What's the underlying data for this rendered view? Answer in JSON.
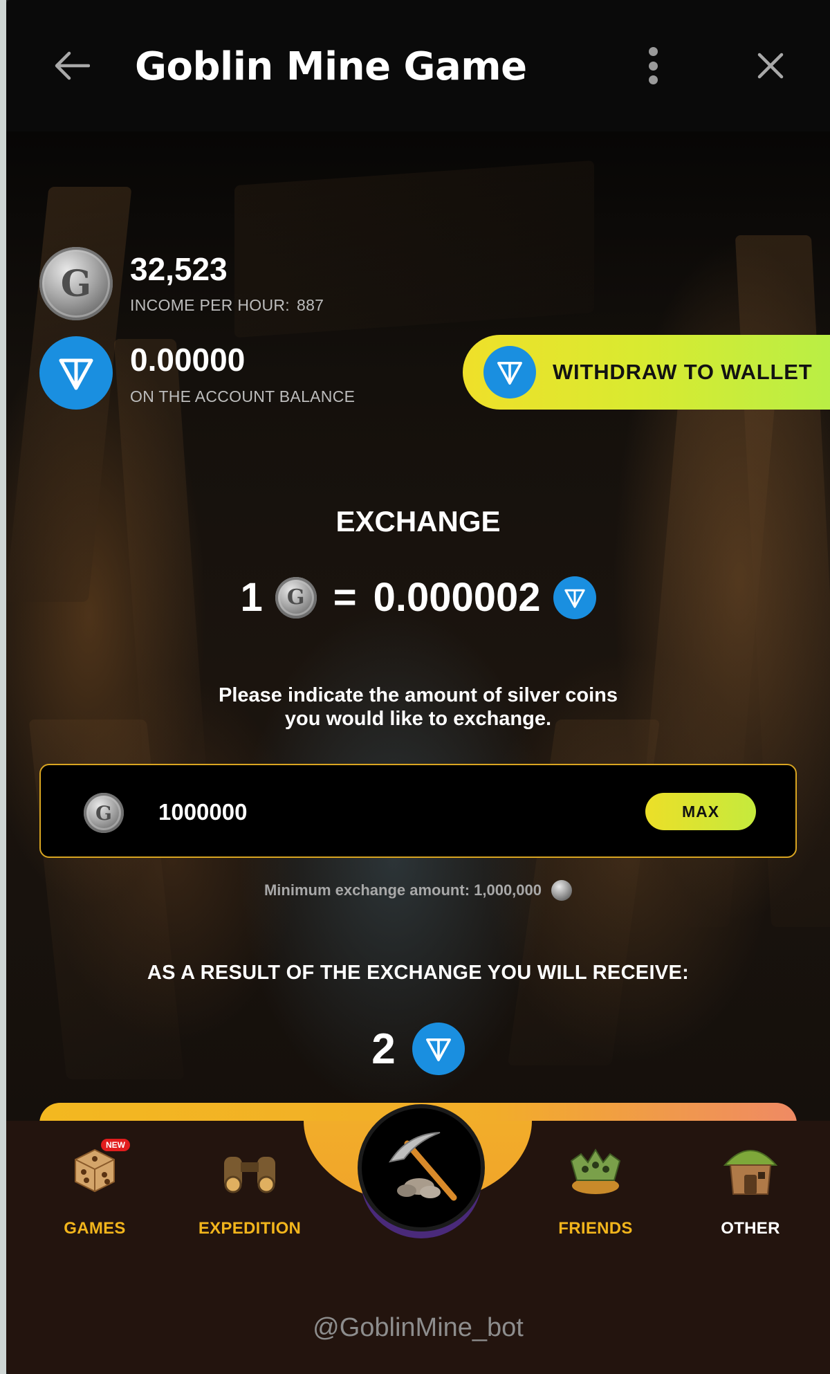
{
  "header": {
    "title": "Goblin Mine Game",
    "back_icon": "arrow-left-icon",
    "menu_icon": "kebab-menu-icon",
    "close_icon": "close-icon"
  },
  "balances": {
    "silver": {
      "value": "32,523",
      "income_label": "INCOME PER HOUR:",
      "income_value": "887",
      "coin_letter": "G"
    },
    "ton": {
      "value": "0.00000",
      "label": "ON THE ACCOUNT BALANCE"
    },
    "withdraw_label": "WITHDRAW TO WALLET"
  },
  "exchange": {
    "title": "EXCHANGE",
    "rate_left": "1",
    "rate_eq": "=",
    "rate_right": "0.000002",
    "instruction_line1": "Please indicate the amount of silver coins",
    "instruction_line2": "you would like to exchange.",
    "amount_value": "1000000",
    "max_label": "MAX",
    "minimum_text": "Minimum exchange amount: 1,000,000",
    "result_label": "AS A RESULT OF THE EXCHANGE YOU WILL RECEIVE:",
    "result_value": "2"
  },
  "nav": {
    "games": {
      "label": "GAMES",
      "badge": "NEW"
    },
    "expedition": {
      "label": "EXPEDITION"
    },
    "mine": {
      "icon": "pickaxe-icon"
    },
    "friends": {
      "label": "FRIENDS"
    },
    "other": {
      "label": "OTHER"
    }
  },
  "footer": {
    "bot_handle": "@GoblinMine_bot"
  },
  "colors": {
    "accent_yellow": "#f2b51c",
    "ton_blue": "#1a8fe0",
    "input_border": "#d9a521",
    "withdraw_gradient_start": "#efe02a",
    "withdraw_gradient_end": "#b6ef47"
  }
}
